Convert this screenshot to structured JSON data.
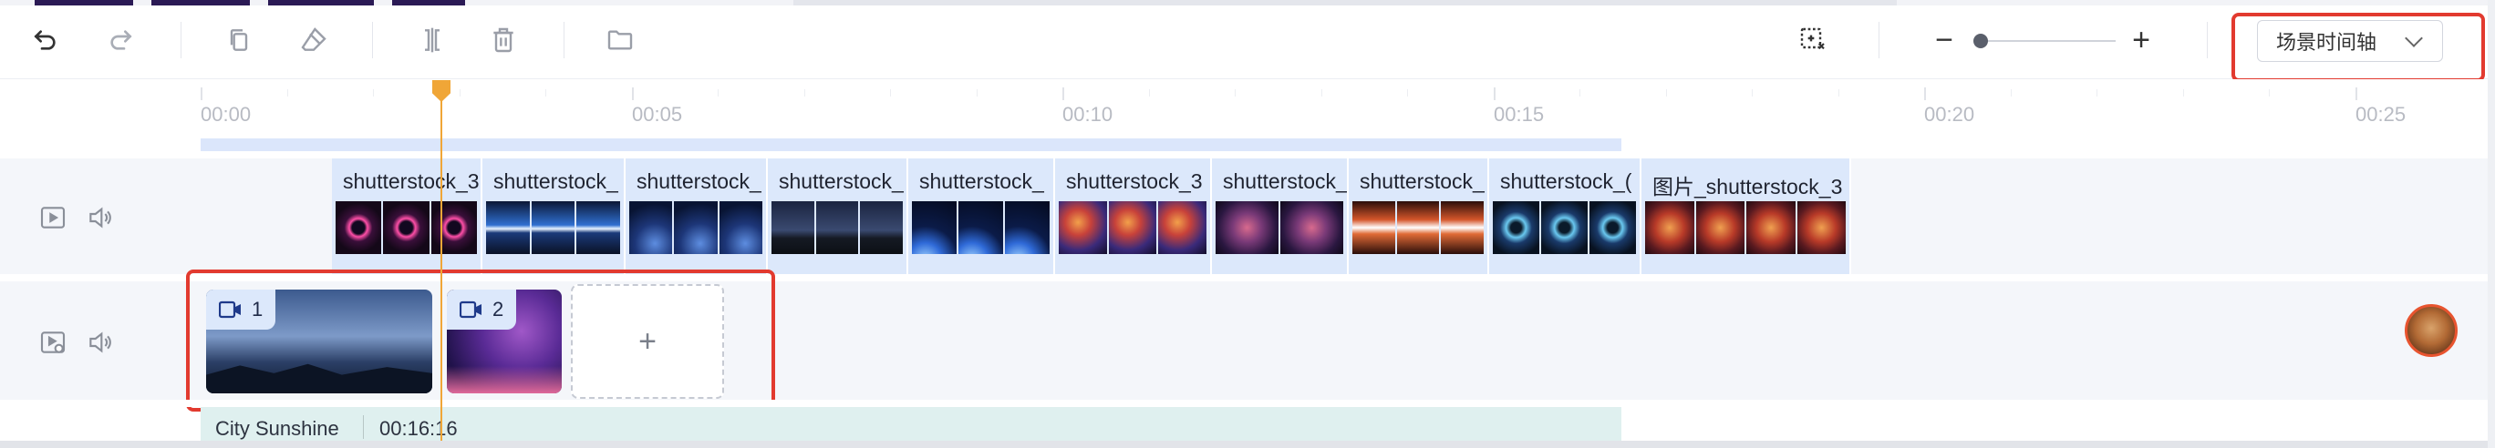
{
  "toolbar": {
    "icons": [
      "undo-icon",
      "redo-icon",
      "copy-icon",
      "clear-icon",
      "split-icon",
      "delete-icon",
      "folder-icon",
      "fit-icon"
    ],
    "zoom": {
      "minus": "−",
      "plus": "+",
      "level": 0.05
    },
    "mode_select": {
      "value": "场景时间轴",
      "chevron": "⌄"
    }
  },
  "ruler": {
    "labels": [
      "00:00",
      "00:05",
      "00:10",
      "00:15",
      "00:20",
      "00:25"
    ]
  },
  "video_track": {
    "clips": [
      {
        "label": "shutterstock_3",
        "theme": "rings"
      },
      {
        "label": "shutterstock_",
        "theme": "aurora"
      },
      {
        "label": "shutterstock_",
        "theme": "stars"
      },
      {
        "label": "shutterstock_",
        "theme": "night"
      },
      {
        "label": "shutterstock_",
        "theme": "earth"
      },
      {
        "label": "shutterstock_3",
        "theme": "nebula"
      },
      {
        "label": "shutterstock_",
        "theme": "galaxy"
      },
      {
        "label": "shutterstock_",
        "theme": "flare"
      },
      {
        "label": "shutterstock_(",
        "theme": "vortex"
      },
      {
        "label": "图片_shutterstock_3",
        "theme": "nebula2"
      }
    ]
  },
  "scene_track": {
    "scenes": [
      {
        "number": "1"
      },
      {
        "number": "2"
      }
    ],
    "add_label": "+"
  },
  "audio_track": {
    "name": "City Sunshine",
    "duration": "00:16:16"
  },
  "colors": {
    "accent_highlight": "#e23a2f",
    "playhead": "#f0a637",
    "clip_bg": "#dce8fb"
  }
}
